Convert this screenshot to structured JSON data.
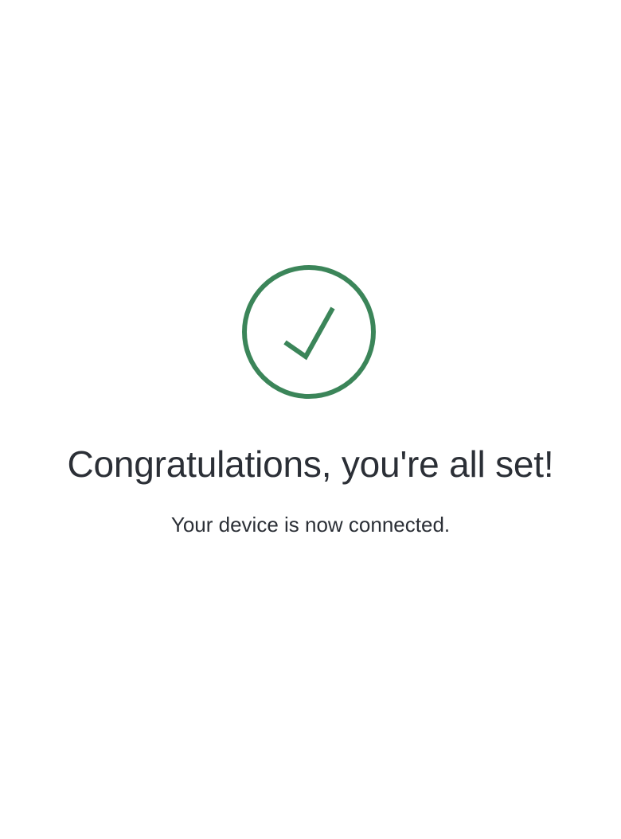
{
  "success": {
    "icon": "checkmark-circle-icon",
    "color": "#3b8559",
    "title": "Congratulations, you're all set!",
    "message": "Your device is now connected."
  },
  "colors": {
    "background": "#ffffff",
    "text": "#2b2f36"
  }
}
